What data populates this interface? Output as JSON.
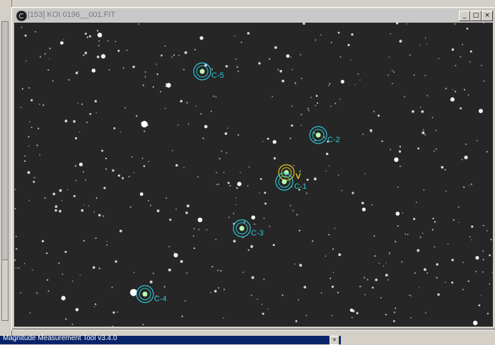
{
  "window": {
    "title": "[153] KOI 0196__001.FIT",
    "buttons": {
      "minimize": "_",
      "maximize": "□",
      "close": "×"
    }
  },
  "image": {
    "markers": [
      {
        "id": "C-5",
        "label": "C-5",
        "color": "#2ec8d8"
      },
      {
        "id": "C-2",
        "label": "C-2",
        "color": "#2ec8d8"
      },
      {
        "id": "V",
        "label": "V",
        "color": "#e8d020"
      },
      {
        "id": "C-1",
        "label": "C-1",
        "color": "#2ec8d8"
      },
      {
        "id": "C-3",
        "label": "C-3",
        "color": "#2ec8d8"
      },
      {
        "id": "C-4",
        "label": "C-4",
        "color": "#2ec8d8"
      }
    ]
  },
  "taskbar": {
    "label": "Magnitude Measurement Tool v3.4.0",
    "close": "×"
  }
}
